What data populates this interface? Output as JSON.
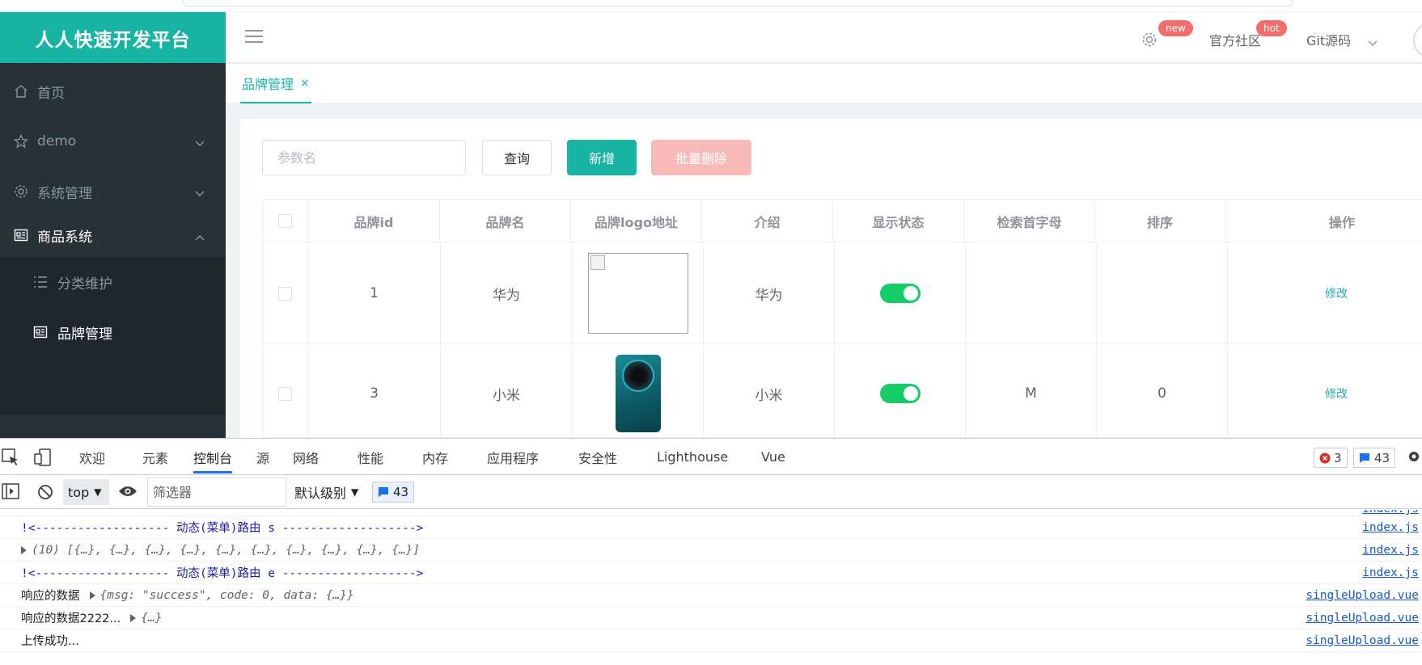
{
  "app": {
    "brand": "人人快速开发平台",
    "accent_color": "#17b3a3"
  },
  "sidebar": {
    "items": [
      {
        "label": "首页",
        "icon": "home-icon"
      },
      {
        "label": "demo",
        "icon": "star-icon"
      },
      {
        "label": "系统管理",
        "icon": "gear-icon"
      },
      {
        "label": "商品系统",
        "icon": "product-icon"
      }
    ],
    "subitems": [
      {
        "label": "分类维护",
        "icon": "list-icon"
      },
      {
        "label": "品牌管理",
        "icon": "product-icon"
      }
    ]
  },
  "header": {
    "badge_new": "new",
    "community": "官方社区",
    "badge_hot": "hot",
    "git": "Git源码"
  },
  "tabs": [
    {
      "label": "品牌管理",
      "close": "×"
    }
  ],
  "toolbar": {
    "search_placeholder": "参数名",
    "query": "查询",
    "add": "新增",
    "batch_delete": "批量删除"
  },
  "table": {
    "columns": [
      "品牌id",
      "品牌名",
      "品牌logo地址",
      "介绍",
      "显示状态",
      "检索首字母",
      "排序",
      "操作"
    ],
    "rows": [
      {
        "id": "1",
        "name": "华为",
        "logo": "broken",
        "desc": "华为",
        "show": true,
        "letter": "",
        "sort": "",
        "action": "修改"
      },
      {
        "id": "3",
        "name": "小米",
        "logo": "phone",
        "desc": "小米",
        "show": true,
        "letter": "M",
        "sort": "0",
        "action": "修改"
      }
    ]
  },
  "devtools": {
    "tabs": [
      "欢迎",
      "元素",
      "控制台",
      "源",
      "网络",
      "性能",
      "内存",
      "应用程序",
      "安全性",
      "Lighthouse",
      "Vue"
    ],
    "active_tab": "控制台",
    "error_count": "3",
    "message_count": "43",
    "context": "top",
    "filter_placeholder": "筛选器",
    "level": "默认级别",
    "level_arrow": "▼",
    "filter_count": "43",
    "logs": [
      {
        "text": "",
        "src": "index.js"
      },
      {
        "text": "!<------------------- 动态(菜单)路由 s ------------------->",
        "src": "index.js"
      },
      {
        "text": "(10) [{…}, {…}, {…}, {…}, {…}, {…}, {…}, {…}, {…}, {…}]",
        "src": "index.js"
      },
      {
        "text": "!<------------------- 动态(菜单)路由 e ------------------->",
        "src": "index.js"
      },
      {
        "prefix": "响应的数据",
        "object": "{msg: \"success\", code: 0, data: {…}}",
        "src": "singleUpload.vue"
      },
      {
        "prefix": "响应的数据2222...",
        "object": "{…}",
        "src": "singleUpload.vue"
      },
      {
        "text": "上传成功...",
        "src": "singleUpload.vue"
      }
    ]
  }
}
